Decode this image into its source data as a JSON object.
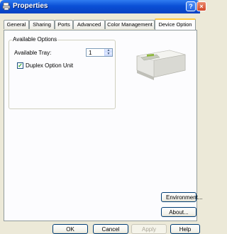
{
  "window": {
    "title": "Properties",
    "help_glyph": "?",
    "close_glyph": "×"
  },
  "tabs": [
    {
      "label": "General"
    },
    {
      "label": "Sharing"
    },
    {
      "label": "Ports"
    },
    {
      "label": "Advanced"
    },
    {
      "label": "Color Management"
    },
    {
      "label": "Device Option",
      "active": true
    }
  ],
  "device_option": {
    "group_title": "Available Options",
    "tray_label": "Available Tray:",
    "tray_value": "1",
    "duplex_label": "Duplex Option Unit",
    "duplex_checked": true,
    "printer_image": "printer-image",
    "environment_button": "Environment...",
    "about_button": "About..."
  },
  "buttons": {
    "ok": "OK",
    "cancel": "Cancel",
    "apply": "Apply",
    "help": "Help"
  },
  "colors": {
    "titlebar": "#0a4fd6",
    "active_tab_highlight": "#ffc83c",
    "dialog_bg": "#ece9d8"
  }
}
